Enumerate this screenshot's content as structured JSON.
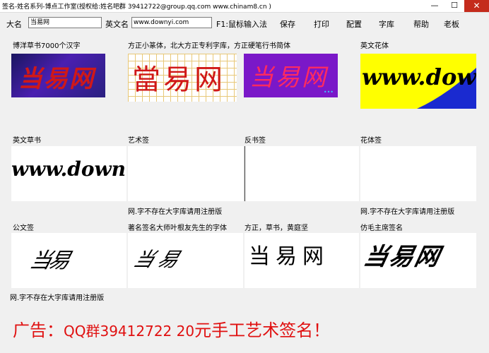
{
  "window": {
    "title": "签名-姓名系列-博点工作室(授权给:姓名吧群 39412722@group.qq.com www.chinam8.cn )"
  },
  "form": {
    "name_label": "大名",
    "name_value": "当易网",
    "en_label": "英文名",
    "en_value": "www.downyi.com",
    "ime_hint": "F1:鼠标输入法"
  },
  "toolbar": {
    "save": "保存",
    "print": "打印",
    "config": "配置",
    "font_lib": "字库",
    "help": "帮助",
    "boss": "老板"
  },
  "cells": [
    {
      "label": "博洋草书7000个汉字",
      "text": "当易网"
    },
    {
      "label": "方正小篆体，北大方正专利字库，方正硬笔行书简体",
      "text": "當易网"
    },
    {
      "label": "",
      "text": "当易网"
    },
    {
      "label": "英文花体",
      "text": "www.dow"
    },
    {
      "label": "英文草书",
      "text": "www.down"
    },
    {
      "label": "艺术签",
      "note": "网.字不存在大字库请用注册版"
    },
    {
      "label": "反书签"
    },
    {
      "label": "花体签",
      "note": "网.字不存在大字库请用注册版"
    },
    {
      "label": "公文签",
      "text": "当易"
    },
    {
      "label": "著名签名大师叶根友先生的字体",
      "text": "当易"
    },
    {
      "label": "方正，草书，黄庭坚",
      "text": "当易网"
    },
    {
      "label": "仿毛主席签名",
      "text": "当易网"
    }
  ],
  "bottom_note": "网.字不存在大字库请用注册版",
  "ad": {
    "prefix": "广告：",
    "middle": "QQ群39412722 20",
    "suffix": "元手工艺术签名！"
  },
  "colors": {
    "ad_red": "#e01010",
    "sig_red": "#d01818",
    "purple": "#7a18c8",
    "yellow": "#ffff00",
    "blue": "#1a2ad0"
  }
}
